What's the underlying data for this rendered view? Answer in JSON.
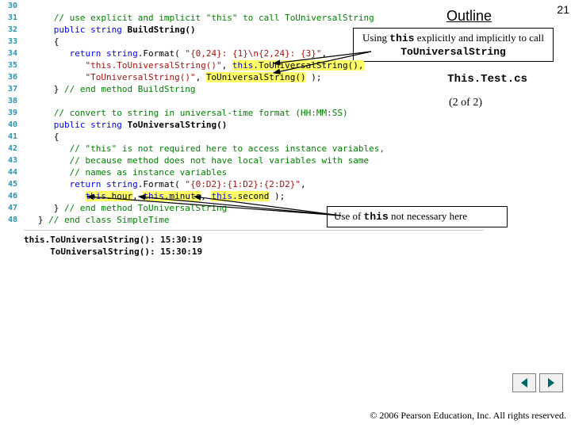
{
  "page_number": "21",
  "outline_label": "Outline",
  "file_label": "This.Test.cs",
  "pager_label": "(2 of 2)",
  "callout1_pre": "Using ",
  "callout1_mono1": "this",
  "callout1_mid": " explicitly and implicitly to call ",
  "callout1_mono2": "ToUniversalString",
  "callout2_pre": "Use of ",
  "callout2_mono": "this",
  "callout2_post": " not necessary here",
  "copyright": "© 2006 Pearson Education, Inc.  All rights reserved.",
  "code": {
    "lines": [
      {
        "n": "30",
        "tokens": [
          {
            "t": "      ",
            "c": ""
          }
        ]
      },
      {
        "n": "31",
        "tokens": [
          {
            "t": "      ",
            "c": ""
          },
          {
            "t": "// use explicit and implicit \"this\" to call ToUniversalString",
            "c": "comment"
          }
        ]
      },
      {
        "n": "32",
        "tokens": [
          {
            "t": "      ",
            "c": ""
          },
          {
            "t": "public",
            "c": "kw"
          },
          {
            "t": " ",
            "c": ""
          },
          {
            "t": "string",
            "c": "kw"
          },
          {
            "t": " ",
            "c": ""
          },
          {
            "t": "BuildString()",
            "c": "black bold"
          }
        ]
      },
      {
        "n": "33",
        "tokens": [
          {
            "t": "      {",
            "c": "black"
          }
        ]
      },
      {
        "n": "34",
        "tokens": [
          {
            "t": "         ",
            "c": ""
          },
          {
            "t": "return",
            "c": "kw"
          },
          {
            "t": " ",
            "c": ""
          },
          {
            "t": "string",
            "c": "kw"
          },
          {
            "t": ".Format( ",
            "c": "black"
          },
          {
            "t": "\"{0,24}: {1}\\n{2,24}: {3}\"",
            "c": "str"
          },
          {
            "t": ",",
            "c": "black"
          }
        ]
      },
      {
        "n": "35",
        "tokens": [
          {
            "t": "            ",
            "c": ""
          },
          {
            "t": "\"this.ToUniversalString()\"",
            "c": "str"
          },
          {
            "t": ", ",
            "c": "black"
          },
          {
            "t": "this",
            "c": "kw hl"
          },
          {
            "t": ".ToUniversalString(),",
            "c": "black hl"
          }
        ]
      },
      {
        "n": "36",
        "tokens": [
          {
            "t": "            ",
            "c": ""
          },
          {
            "t": "\"ToUniversalString()\"",
            "c": "str"
          },
          {
            "t": ", ",
            "c": "black"
          },
          {
            "t": "ToUniversalString()",
            "c": "black hl"
          },
          {
            "t": " );",
            "c": "black"
          }
        ]
      },
      {
        "n": "37",
        "tokens": [
          {
            "t": "      } ",
            "c": "black"
          },
          {
            "t": "// end method BuildString",
            "c": "comment"
          }
        ]
      },
      {
        "n": "38",
        "tokens": [
          {
            "t": "",
            "c": ""
          }
        ]
      },
      {
        "n": "39",
        "tokens": [
          {
            "t": "      ",
            "c": ""
          },
          {
            "t": "// convert to string in universal-time format (HH:MM:SS)",
            "c": "comment"
          }
        ]
      },
      {
        "n": "40",
        "tokens": [
          {
            "t": "      ",
            "c": ""
          },
          {
            "t": "public",
            "c": "kw"
          },
          {
            "t": " ",
            "c": ""
          },
          {
            "t": "string",
            "c": "kw"
          },
          {
            "t": " ",
            "c": ""
          },
          {
            "t": "ToUniversalString()",
            "c": "black bold"
          }
        ]
      },
      {
        "n": "41",
        "tokens": [
          {
            "t": "      {",
            "c": "black"
          }
        ]
      },
      {
        "n": "42",
        "tokens": [
          {
            "t": "         ",
            "c": ""
          },
          {
            "t": "// \"this\" is not required here to access instance variables,",
            "c": "comment"
          }
        ]
      },
      {
        "n": "43",
        "tokens": [
          {
            "t": "         ",
            "c": ""
          },
          {
            "t": "// because method does not have local variables with same",
            "c": "comment"
          }
        ]
      },
      {
        "n": "44",
        "tokens": [
          {
            "t": "         ",
            "c": ""
          },
          {
            "t": "// names as instance variables",
            "c": "comment"
          }
        ]
      },
      {
        "n": "45",
        "tokens": [
          {
            "t": "         ",
            "c": ""
          },
          {
            "t": "return",
            "c": "kw"
          },
          {
            "t": " ",
            "c": ""
          },
          {
            "t": "string",
            "c": "kw"
          },
          {
            "t": ".Format( ",
            "c": "black"
          },
          {
            "t": "\"{0:D2}:{1:D2}:{2:D2}\"",
            "c": "str"
          },
          {
            "t": ",",
            "c": "black"
          }
        ]
      },
      {
        "n": "46",
        "tokens": [
          {
            "t": "            ",
            "c": ""
          },
          {
            "t": "this",
            "c": "kw hl"
          },
          {
            "t": ".hour",
            "c": "black hl"
          },
          {
            "t": ", ",
            "c": "black"
          },
          {
            "t": "this",
            "c": "kw hl"
          },
          {
            "t": ".minute",
            "c": "black hl"
          },
          {
            "t": ", ",
            "c": "black"
          },
          {
            "t": "this",
            "c": "kw hl"
          },
          {
            "t": ".second",
            "c": "black hl"
          },
          {
            "t": " );",
            "c": "black"
          }
        ]
      },
      {
        "n": "47",
        "tokens": [
          {
            "t": "      } ",
            "c": "black"
          },
          {
            "t": "// end method ToUniversalString",
            "c": "comment"
          }
        ]
      },
      {
        "n": "48",
        "tokens": [
          {
            "t": "   } ",
            "c": "black"
          },
          {
            "t": "// end class SimpleTime",
            "c": "comment"
          }
        ]
      }
    ]
  },
  "output": "this.ToUniversalString(): 15:30:19\n     ToUniversalString(): 15:30:19"
}
